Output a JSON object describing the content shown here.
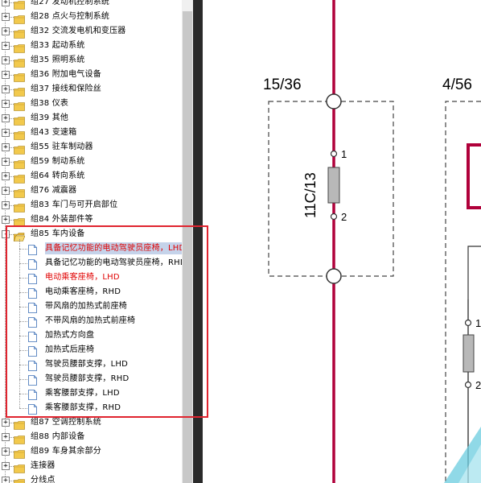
{
  "tree": {
    "groups_top": [
      {
        "expander": "+",
        "label": "组27 发动机控制系统"
      },
      {
        "expander": "+",
        "label": "组28 点火与控制系统"
      },
      {
        "expander": "+",
        "label": "组32 交流发电机和变压器"
      },
      {
        "expander": "+",
        "label": "组33 起动系统"
      },
      {
        "expander": "+",
        "label": "组35 照明系统"
      },
      {
        "expander": "+",
        "label": "组36 附加电气设备"
      },
      {
        "expander": "+",
        "label": "组37 接线和保险丝"
      },
      {
        "expander": "+",
        "label": "组38 仪表"
      },
      {
        "expander": "+",
        "label": "组39 其他"
      },
      {
        "expander": "+",
        "label": "组43 变速箱"
      },
      {
        "expander": "+",
        "label": "组55 驻车制动器"
      },
      {
        "expander": "+",
        "label": "组59 制动系统"
      },
      {
        "expander": "+",
        "label": "组64 转向系统"
      },
      {
        "expander": "+",
        "label": "组76 减震器"
      },
      {
        "expander": "+",
        "label": "组83 车门与可开启部位"
      },
      {
        "expander": "+",
        "label": "组84 外装部件等"
      }
    ],
    "open_group": {
      "expander": "-",
      "label": "组85 车内设备"
    },
    "children": [
      {
        "label": "具备记忆功能的电动驾驶员座椅，LHD",
        "style": "red sel"
      },
      {
        "label": "具备记忆功能的电动驾驶员座椅，RHD",
        "style": ""
      },
      {
        "label": "电动乘客座椅，LHD",
        "style": "red"
      },
      {
        "label": "电动乘客座椅，RHD",
        "style": ""
      },
      {
        "label": "带风扇的加热式前座椅",
        "style": ""
      },
      {
        "label": "不带风扇的加热式前座椅",
        "style": ""
      },
      {
        "label": "加热式方向盘",
        "style": ""
      },
      {
        "label": "加热式后座椅",
        "style": ""
      },
      {
        "label": "驾驶员腰部支撑，LHD",
        "style": ""
      },
      {
        "label": "驾驶员腰部支撑，RHD",
        "style": ""
      },
      {
        "label": "乘客腰部支撑，LHD",
        "style": ""
      },
      {
        "label": "乘客腰部支撑，RHD",
        "style": ""
      }
    ],
    "groups_bottom": [
      {
        "expander": "+",
        "label": "组87 空调控制系统"
      },
      {
        "expander": "+",
        "label": "组88 内部设备"
      },
      {
        "expander": "+",
        "label": "组89 车身其余部分"
      },
      {
        "expander": "+",
        "label": "连接器"
      },
      {
        "expander": "+",
        "label": "分线点"
      }
    ]
  },
  "diagram": {
    "ref_left": "15/36",
    "ref_right": "4/56",
    "fuse_label": "11C/13",
    "pin_1": "1",
    "pin_2": "2",
    "pin_1_right": "1",
    "pin_2_right": "2",
    "wire_color": "#b0003a",
    "highlight_color": "#e0242f"
  }
}
